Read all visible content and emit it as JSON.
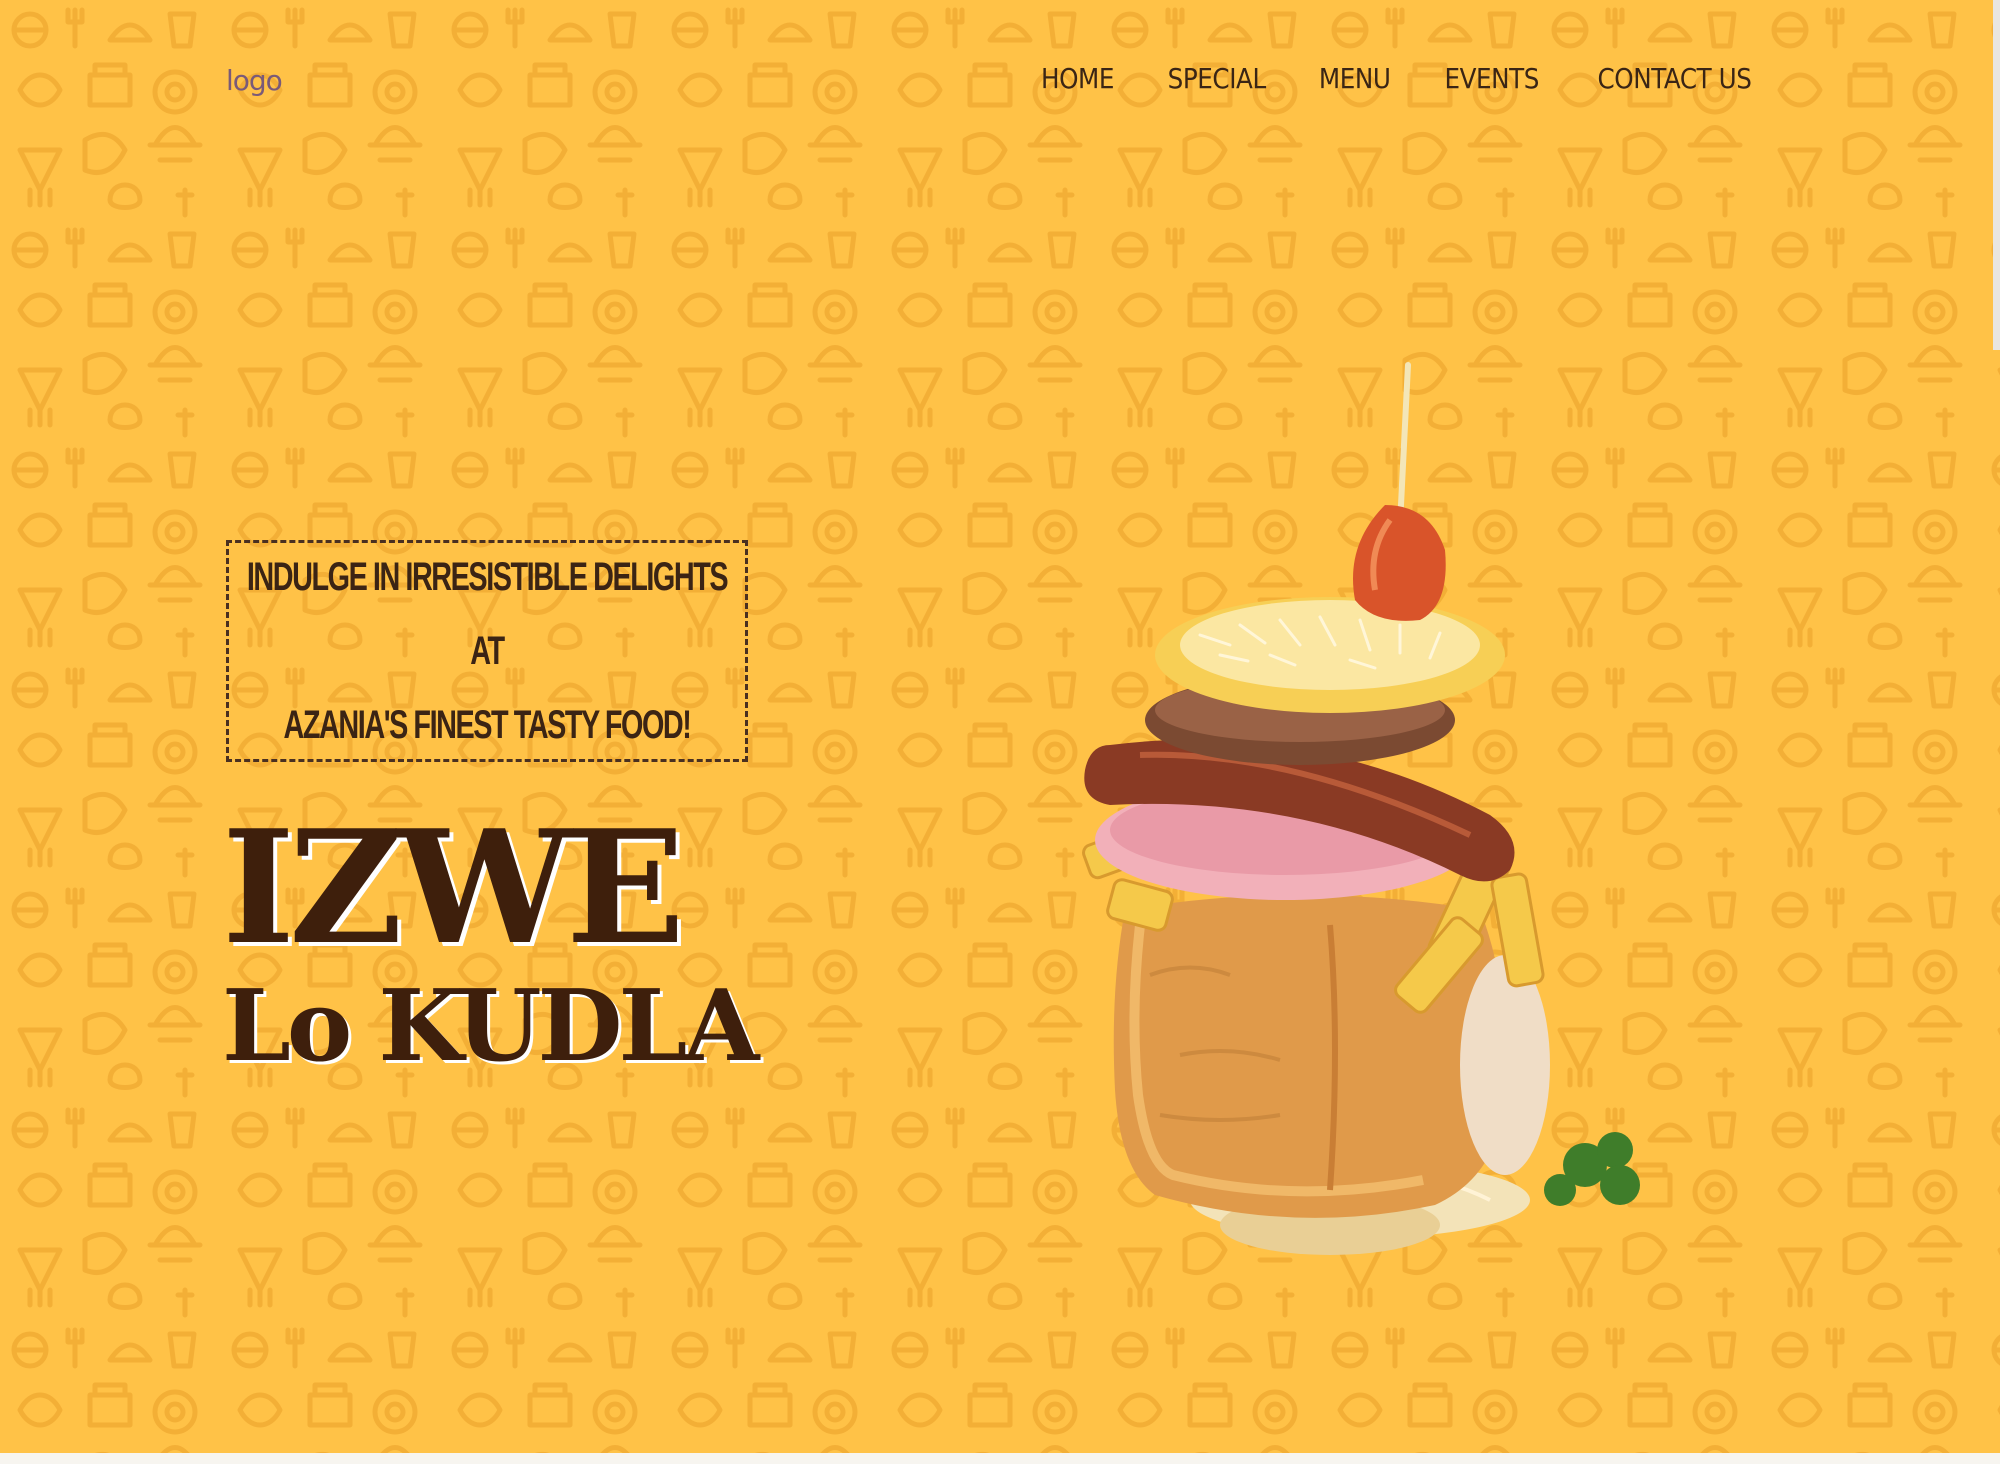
{
  "header": {
    "logo_text": "logo",
    "nav": [
      {
        "label": "HOME"
      },
      {
        "label": "SPECIAL"
      },
      {
        "label": "MENU"
      },
      {
        "label": "EVENTS"
      },
      {
        "label": "CONTACT US"
      }
    ]
  },
  "hero": {
    "tagline_line1": "INDULGE IN IRRESISTIBLE DELIGHTS AT",
    "tagline_line2": "AZANIA'S FINEST TASTY FOOD!",
    "title_line1": "IZWE",
    "title_line2": "Lo KUDLA"
  },
  "colors": {
    "background": "#ffc247",
    "pattern": "#f5b23a",
    "nav_text": "#3a2515",
    "title_text": "#3e1f0c"
  },
  "icons": [
    "food-doodle-pattern",
    "kota-sandwich-image"
  ]
}
